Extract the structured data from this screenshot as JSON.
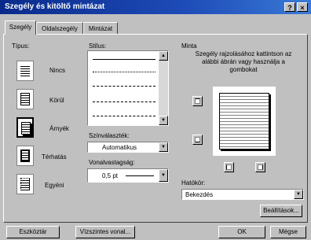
{
  "window": {
    "title": "Szegély és kitöltő mintázat",
    "help_glyph": "?",
    "close_glyph": "×"
  },
  "tabs": [
    {
      "label": "Szegély",
      "active": true
    },
    {
      "label": "Oldalszegély",
      "active": false
    },
    {
      "label": "Mintázat",
      "active": false
    }
  ],
  "type_section": {
    "label": "Típus:",
    "presets": [
      {
        "label": "Nincs",
        "active": false
      },
      {
        "label": "Körül",
        "active": false
      },
      {
        "label": "Árnyék",
        "active": true
      },
      {
        "label": "Térhatás",
        "active": false
      },
      {
        "label": "Egyéni",
        "active": false
      }
    ]
  },
  "style_section": {
    "label": "Stílus:",
    "line_styles": [
      "solid",
      "dotted",
      "dashed-short",
      "dashed",
      "dash-dot"
    ],
    "color_label": "Színválaszték:",
    "color_value": "Automatikus",
    "width_label": "Vonalvastagság:",
    "width_value": "0,5 pt"
  },
  "preview_section": {
    "label": "Minta",
    "instructions": "Szegély rajzolásához kattintson az alábbi ábrán vagy használja a gombokat",
    "scope_label": "Hatókör:",
    "scope_value": "Bekezdés",
    "options_button": "Beállítások..."
  },
  "footer": {
    "toolbar_button": "Eszköztár",
    "horizontal_line_button": "Vízszintes vonal...",
    "ok_button": "OK",
    "cancel_button": "Mégse"
  },
  "colors": {
    "title_start": "#0a2a8a",
    "title_end": "#3a7ad6",
    "face": "#c0c0c0"
  }
}
